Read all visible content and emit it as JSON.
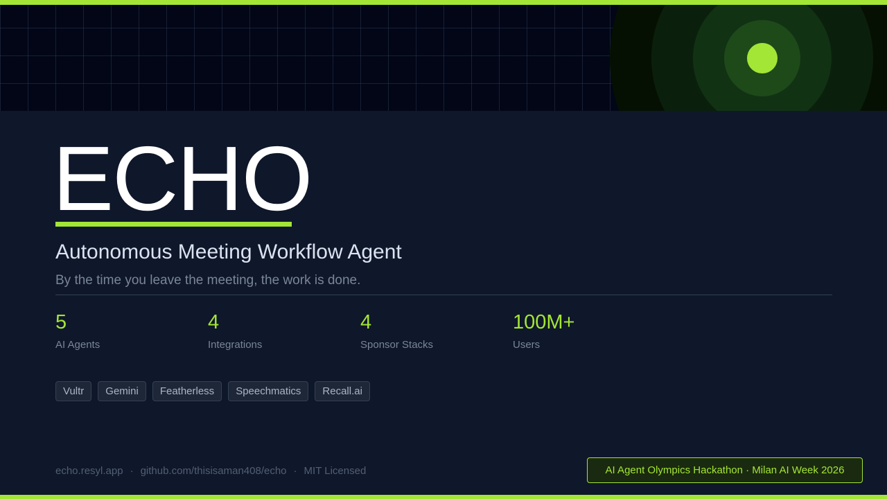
{
  "brand": {
    "title": "ECHO",
    "subtitle": "Autonomous Meeting Workflow Agent",
    "tagline": "By the time you leave the meeting, the work is done."
  },
  "stats": [
    {
      "value": "5",
      "label": "AI Agents"
    },
    {
      "value": "4",
      "label": "Integrations"
    },
    {
      "value": "4",
      "label": "Sponsor Stacks"
    },
    {
      "value": "100M+",
      "label": "Users"
    }
  ],
  "tags": [
    "Vultr",
    "Gemini",
    "Featherless",
    "Speechmatics",
    "Recall.ai"
  ],
  "footer": {
    "links": [
      "echo.resyl.app",
      "github.com/thisisaman408/echo",
      "MIT Licensed"
    ],
    "separator": "·",
    "event": "AI Agent Olympics Hackathon · Milan AI Week 2026"
  },
  "colors": {
    "accent": "#a3e635",
    "background": "#0f172a",
    "header": "#020617"
  }
}
